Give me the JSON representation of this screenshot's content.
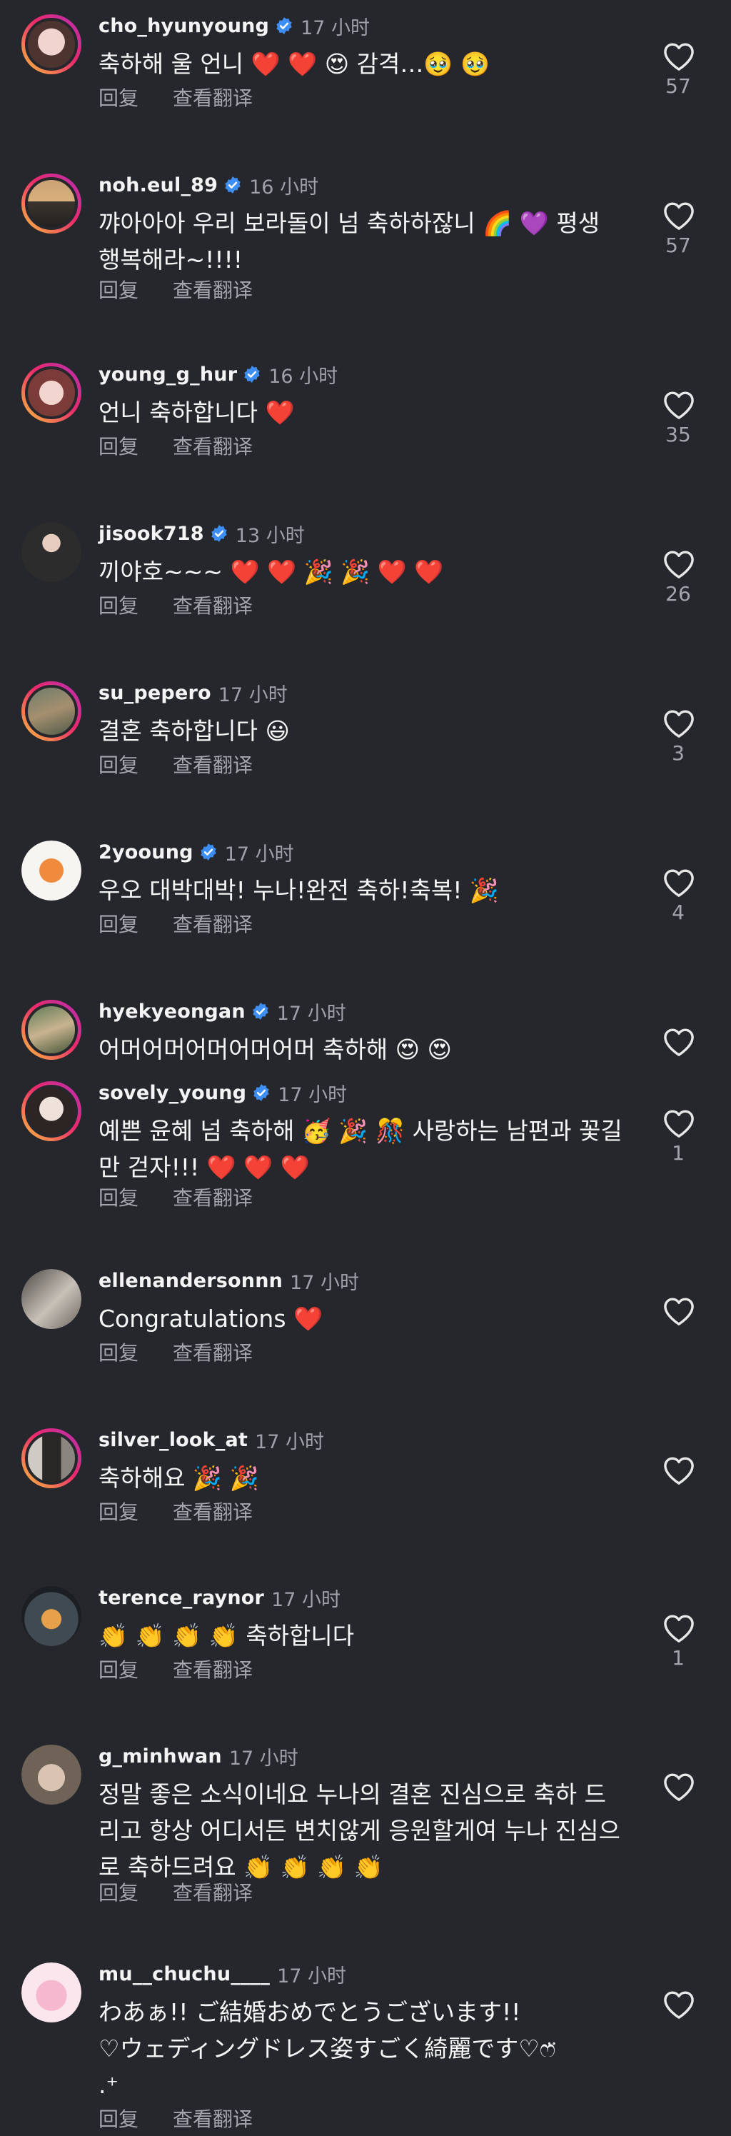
{
  "colors": {
    "background": "#25272c",
    "verified": "#3d8ff5",
    "ring_gradient": [
      "#f9c23c",
      "#ec2a6b",
      "#b52fb8"
    ]
  },
  "labels": {
    "reply": "回复",
    "translate": "查看翻译"
  },
  "comments": [
    {
      "username": "cho_hyunyoung",
      "verified": true,
      "time": "17 小时",
      "text": "축하해 울 언니 ❤️ ❤️ 😍 감격…🥹 🥹",
      "likes": "57",
      "story_ring": true
    },
    {
      "username": "noh.eul_89",
      "verified": true,
      "time": "16 小时",
      "text": "꺄아아아 우리 보라돌이 넘 축하하잖니 🌈 💜 평생 행복해라~!!!!",
      "likes": "57",
      "story_ring": true
    },
    {
      "username": "young_g_hur",
      "verified": true,
      "time": "16 小时",
      "text": "언니 축하합니다 ❤️",
      "likes": "35",
      "story_ring": true
    },
    {
      "username": "jisook718",
      "verified": true,
      "time": "13 小时",
      "text": "끼야호~~~ ❤️ ❤️ 🎉 🎉 ❤️ ❤️",
      "likes": "26",
      "story_ring": false
    },
    {
      "username": "su_pepero",
      "verified": false,
      "time": "17 小时",
      "text": "결혼 축하합니다 😃",
      "likes": "3",
      "story_ring": true
    },
    {
      "username": "2yooung",
      "verified": true,
      "time": "17 小时",
      "text": "우오 대박대박! 누나!완전 축하!축복! 🎉",
      "likes": "4",
      "story_ring": false
    },
    {
      "username": "hyekyeongan",
      "verified": true,
      "time": "17 小时",
      "text": "어머어머어머어머어머 축하해 😍 😍",
      "likes": "",
      "story_ring": true
    },
    {
      "username": "sovely_young",
      "verified": true,
      "time": "17 小时",
      "text": "예쁜 윤혜 넘 축하해 🥳 🎉 🎊 사랑하는 남편과 꽃길만 걷자!!! ❤️ ❤️ ❤️",
      "likes": "1",
      "story_ring": true
    },
    {
      "username": "ellenandersonnn",
      "verified": false,
      "time": "17 小时",
      "text": "Congratulations ❤️",
      "likes": "",
      "story_ring": false
    },
    {
      "username": "silver_look_at",
      "verified": false,
      "time": "17 小时",
      "text": "축하해요 🎉 🎉",
      "likes": "",
      "story_ring": true
    },
    {
      "username": "terence_raynor",
      "verified": false,
      "time": "17 小时",
      "text": "👏 👏 👏 👏 축하합니다",
      "likes": "1",
      "story_ring": false
    },
    {
      "username": "g_minhwan",
      "verified": false,
      "time": "17 小时",
      "text": "정말 좋은 소식이네요 누나의 결혼 진심으로 축하 드리고 항상 어디서든 변치않게 응원할게여 누나 진심으로 축하드려요 👏 👏 👏 👏",
      "likes": "",
      "story_ring": false
    },
    {
      "username": "mu__chuchu____",
      "verified": false,
      "time": "17 小时",
      "text": "わあぁ!! ご結婚おめでとうございます!!\n♡ウェディングドレス姿すごく綺麗です♡ෆ̈\n.⁺",
      "likes": "",
      "story_ring": false
    }
  ]
}
